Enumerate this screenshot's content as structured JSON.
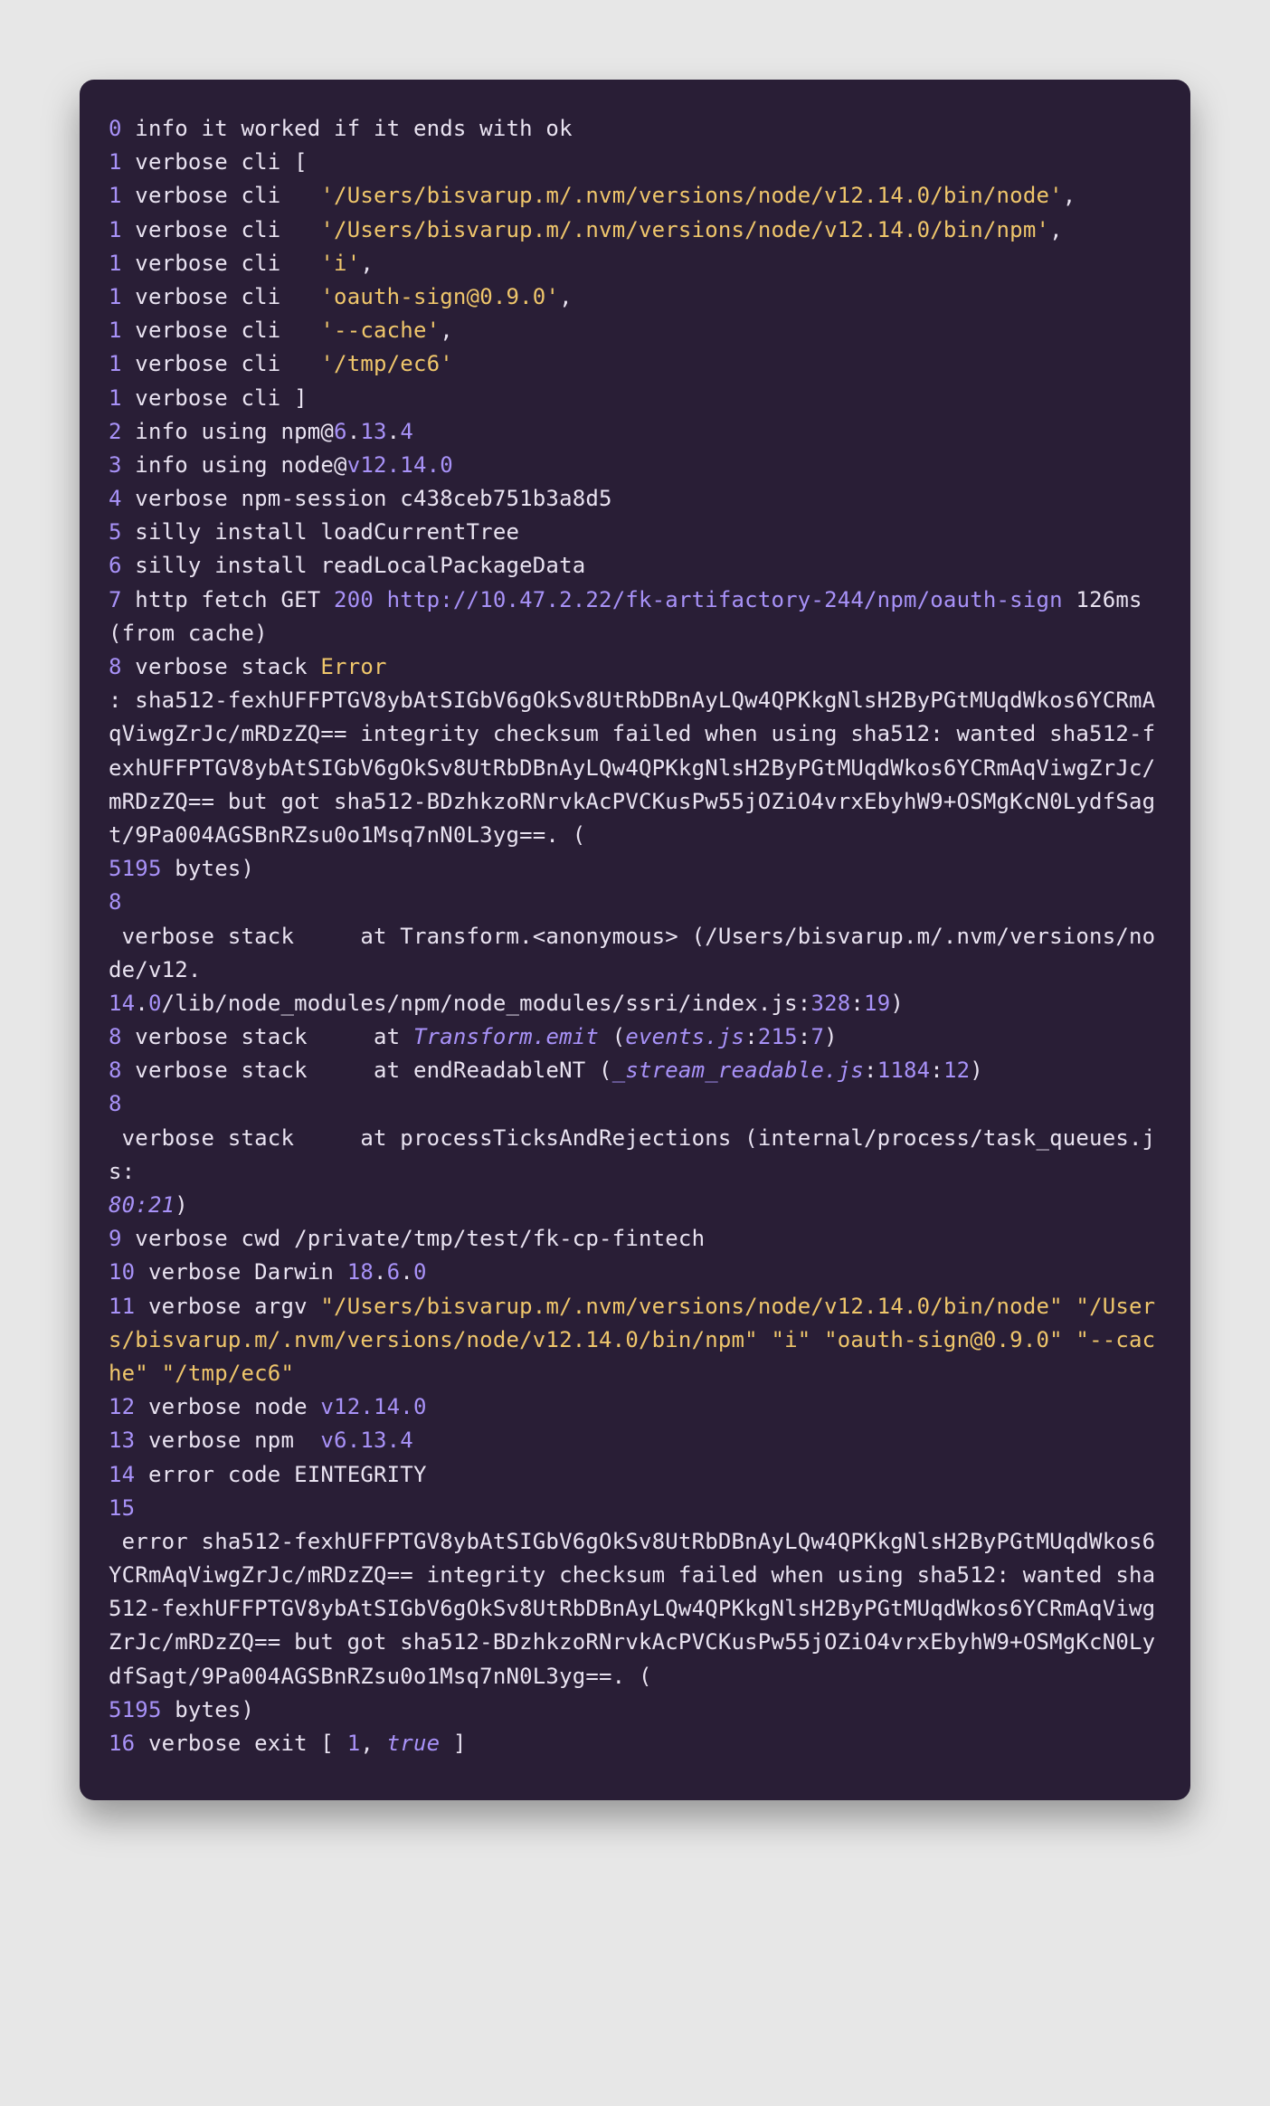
{
  "log_lines": [
    [
      {
        "cls": "num",
        "t": "0"
      },
      {
        "cls": "plain",
        "t": " info it worked if it ends with ok"
      }
    ],
    [
      {
        "cls": "num",
        "t": "1"
      },
      {
        "cls": "plain",
        "t": " verbose cli ["
      }
    ],
    [
      {
        "cls": "num",
        "t": "1"
      },
      {
        "cls": "plain",
        "t": " verbose cli   "
      },
      {
        "cls": "str",
        "t": "'/Users/bisvarup.m/.nvm/versions/node/v12.14.0/bin/node'"
      },
      {
        "cls": "plain",
        "t": ","
      }
    ],
    [
      {
        "cls": "num",
        "t": "1"
      },
      {
        "cls": "plain",
        "t": " verbose cli   "
      },
      {
        "cls": "str",
        "t": "'/Users/bisvarup.m/.nvm/versions/node/v12.14.0/bin/npm'"
      },
      {
        "cls": "plain",
        "t": ","
      }
    ],
    [
      {
        "cls": "num",
        "t": "1"
      },
      {
        "cls": "plain",
        "t": " verbose cli   "
      },
      {
        "cls": "str",
        "t": "'i'"
      },
      {
        "cls": "plain",
        "t": ","
      }
    ],
    [
      {
        "cls": "num",
        "t": "1"
      },
      {
        "cls": "plain",
        "t": " verbose cli   "
      },
      {
        "cls": "str",
        "t": "'oauth-sign@0.9.0'"
      },
      {
        "cls": "plain",
        "t": ","
      }
    ],
    [
      {
        "cls": "num",
        "t": "1"
      },
      {
        "cls": "plain",
        "t": " verbose cli   "
      },
      {
        "cls": "str",
        "t": "'--cache'"
      },
      {
        "cls": "plain",
        "t": ","
      }
    ],
    [
      {
        "cls": "num",
        "t": "1"
      },
      {
        "cls": "plain",
        "t": " verbose cli   "
      },
      {
        "cls": "str",
        "t": "'/tmp/ec6'"
      }
    ],
    [
      {
        "cls": "num",
        "t": "1"
      },
      {
        "cls": "plain",
        "t": " verbose cli ]"
      }
    ],
    [
      {
        "cls": "num",
        "t": "2"
      },
      {
        "cls": "plain",
        "t": " info using npm@"
      },
      {
        "cls": "num",
        "t": "6"
      },
      {
        "cls": "plain",
        "t": "."
      },
      {
        "cls": "num",
        "t": "13"
      },
      {
        "cls": "plain",
        "t": "."
      },
      {
        "cls": "num",
        "t": "4"
      }
    ],
    [
      {
        "cls": "num",
        "t": "3"
      },
      {
        "cls": "plain",
        "t": " info using node@"
      },
      {
        "cls": "http",
        "t": "v12.14.0"
      }
    ],
    [
      {
        "cls": "num",
        "t": "4"
      },
      {
        "cls": "plain",
        "t": " verbose npm-session c438ceb751b3a8d5"
      }
    ],
    [
      {
        "cls": "num",
        "t": "5"
      },
      {
        "cls": "plain",
        "t": " silly install loadCurrentTree"
      }
    ],
    [
      {
        "cls": "num",
        "t": "6"
      },
      {
        "cls": "plain",
        "t": " silly install readLocalPackageData"
      }
    ],
    [
      {
        "cls": "num",
        "t": "7"
      },
      {
        "cls": "plain",
        "t": " http fetch GET "
      },
      {
        "cls": "num",
        "t": "200"
      },
      {
        "cls": "plain",
        "t": " "
      },
      {
        "cls": "http",
        "t": "http://10.47.2.22/fk-artifactory-244/npm/oauth-sign"
      },
      {
        "cls": "plain",
        "t": " 126ms (from cache)"
      }
    ],
    [
      {
        "cls": "num",
        "t": "8"
      },
      {
        "cls": "plain",
        "t": " verbose stack "
      },
      {
        "cls": "err",
        "t": "Error"
      }
    ],
    [
      {
        "cls": "plain",
        "t": ": sha512-fexhUFFPTGV8ybAtSIGbV6gOkSv8UtRbDBnAyLQw4QPKkgNlsH2ByPGtMUqdWkos6YCRmAqViwgZrJc/mRDzZQ== integrity checksum failed when using sha512: wanted sha512-fexhUFFPTGV8ybAtSIGbV6gOkSv8UtRbDBnAyLQw4QPKkgNlsH2ByPGtMUqdWkos6YCRmAqViwgZrJc/mRDzZQ== but got sha512-BDzhkzoRNrvkAcPVCKusPw55jOZiO4vrxEbyhW9+OSMgKcN0LydfSagt/9Pa004AGSBnRZsu0o1Msq7nN0L3yg==. ("
      }
    ],
    [
      {
        "cls": "num",
        "t": "5195"
      },
      {
        "cls": "plain",
        "t": " bytes)"
      }
    ],
    [
      {
        "cls": "num",
        "t": "8"
      }
    ],
    [
      {
        "cls": "plain",
        "t": " verbose stack     at Transform.<anonymous> (/Users/bisvarup.m/.nvm/versions/node/v12."
      }
    ],
    [
      {
        "cls": "num",
        "t": "14"
      },
      {
        "cls": "plain",
        "t": "."
      },
      {
        "cls": "num",
        "t": "0"
      },
      {
        "cls": "plain",
        "t": "/lib/node_modules/npm/node_modules/ssri/index.js:"
      },
      {
        "cls": "num",
        "t": "328"
      },
      {
        "cls": "plain",
        "t": ":"
      },
      {
        "cls": "num",
        "t": "19"
      },
      {
        "cls": "plain",
        "t": ")"
      }
    ],
    [
      {
        "cls": "num",
        "t": "8"
      },
      {
        "cls": "plain",
        "t": " verbose stack     at "
      },
      {
        "cls": "emit",
        "t": "Transform.emit"
      },
      {
        "cls": "plain",
        "t": " ("
      },
      {
        "cls": "file",
        "t": "events.js"
      },
      {
        "cls": "plain",
        "t": ":"
      },
      {
        "cls": "num",
        "t": "215"
      },
      {
        "cls": "plain",
        "t": ":"
      },
      {
        "cls": "num",
        "t": "7"
      },
      {
        "cls": "plain",
        "t": ")"
      }
    ],
    [
      {
        "cls": "num",
        "t": "8"
      },
      {
        "cls": "plain",
        "t": " verbose stack     at endReadableNT ("
      },
      {
        "cls": "file",
        "t": "_stream_readable.js"
      },
      {
        "cls": "plain",
        "t": ":"
      },
      {
        "cls": "num",
        "t": "1184"
      },
      {
        "cls": "plain",
        "t": ":"
      },
      {
        "cls": "num",
        "t": "12"
      },
      {
        "cls": "plain",
        "t": ")"
      }
    ],
    [
      {
        "cls": "num",
        "t": "8"
      }
    ],
    [
      {
        "cls": "plain",
        "t": " verbose stack     at processTicksAndRejections (internal/process/task_queues.js:"
      }
    ],
    [
      {
        "cls": "file",
        "t": "80:21"
      },
      {
        "cls": "plain",
        "t": ")"
      }
    ],
    [
      {
        "cls": "num",
        "t": "9"
      },
      {
        "cls": "plain",
        "t": " verbose cwd /private/tmp/test/fk-cp-fintech"
      }
    ],
    [
      {
        "cls": "num",
        "t": "10"
      },
      {
        "cls": "plain",
        "t": " verbose Darwin "
      },
      {
        "cls": "num",
        "t": "18"
      },
      {
        "cls": "plain",
        "t": "."
      },
      {
        "cls": "num",
        "t": "6"
      },
      {
        "cls": "plain",
        "t": "."
      },
      {
        "cls": "num",
        "t": "0"
      }
    ],
    [
      {
        "cls": "num",
        "t": "11"
      },
      {
        "cls": "plain",
        "t": " verbose argv "
      },
      {
        "cls": "str",
        "t": "\"/Users/bisvarup.m/.nvm/versions/node/v12.14.0/bin/node\""
      },
      {
        "cls": "plain",
        "t": " "
      },
      {
        "cls": "str",
        "t": "\"/Users/bisvarup.m/.nvm/versions/node/v12.14.0/bin/npm\""
      },
      {
        "cls": "plain",
        "t": " "
      },
      {
        "cls": "str",
        "t": "\"i\""
      },
      {
        "cls": "plain",
        "t": " "
      },
      {
        "cls": "str",
        "t": "\"oauth-sign@0.9.0\""
      },
      {
        "cls": "plain",
        "t": " "
      },
      {
        "cls": "str",
        "t": "\"--cache\""
      },
      {
        "cls": "plain",
        "t": " "
      },
      {
        "cls": "str",
        "t": "\"/tmp/ec6\""
      }
    ],
    [
      {
        "cls": "num",
        "t": "12"
      },
      {
        "cls": "plain",
        "t": " verbose node "
      },
      {
        "cls": "http",
        "t": "v12.14.0"
      }
    ],
    [
      {
        "cls": "num",
        "t": "13"
      },
      {
        "cls": "plain",
        "t": " verbose npm  "
      },
      {
        "cls": "http",
        "t": "v6.13.4"
      }
    ],
    [
      {
        "cls": "num",
        "t": "14"
      },
      {
        "cls": "plain",
        "t": " error code EINTEGRITY"
      }
    ],
    [
      {
        "cls": "num",
        "t": "15"
      }
    ],
    [
      {
        "cls": "plain",
        "t": " error sha512-fexhUFFPTGV8ybAtSIGbV6gOkSv8UtRbDBnAyLQw4QPKkgNlsH2ByPGtMUqdWkos6YCRmAqViwgZrJc/mRDzZQ== integrity checksum failed when using sha512: wanted sha512-fexhUFFPTGV8ybAtSIGbV6gOkSv8UtRbDBnAyLQw4QPKkgNlsH2ByPGtMUqdWkos6YCRmAqViwgZrJc/mRDzZQ== but got sha512-BDzhkzoRNrvkAcPVCKusPw55jOZiO4vrxEbyhW9+OSMgKcN0LydfSagt/9Pa004AGSBnRZsu0o1Msq7nN0L3yg==. ("
      }
    ],
    [
      {
        "cls": "num",
        "t": "5195"
      },
      {
        "cls": "plain",
        "t": " bytes)"
      }
    ],
    [
      {
        "cls": "num",
        "t": "16"
      },
      {
        "cls": "plain",
        "t": " verbose exit [ "
      },
      {
        "cls": "num",
        "t": "1"
      },
      {
        "cls": "plain",
        "t": ", "
      },
      {
        "cls": "bool",
        "t": "true"
      },
      {
        "cls": "plain",
        "t": " ]"
      }
    ]
  ]
}
